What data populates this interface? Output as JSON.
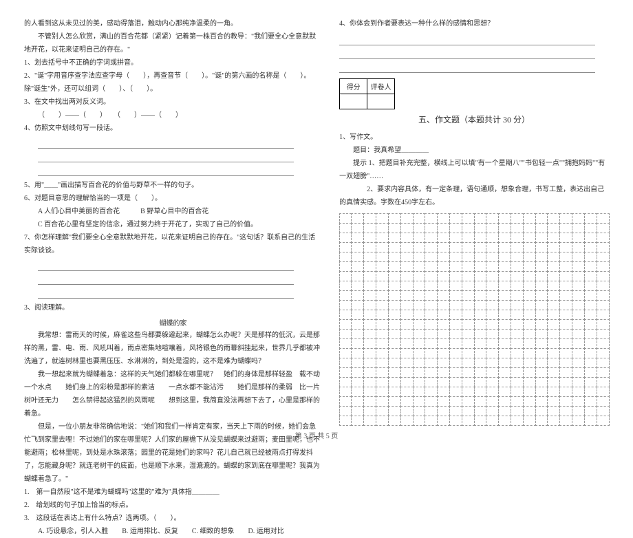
{
  "left": {
    "p_intro1": "的人看到这从未见过的美，感动得落泪，触动内心那纯净温柔的一角。",
    "p_intro2": "不管别人怎么欣赏，满山的百合花都（紧紧）记着第一株百合的教导：\"我们要全心全意默默地开花，以花来证明自己的存在。\"",
    "q1": "1、划去括号中不正确的字词或拼音。",
    "q2": "2、\"诞\"字用音序查字法应查字母（　　），再查音节（　　）。\"诞\"的第六画的名称是（　　）。除\"诞生\"外，还可以组词（　　）、（　　）。",
    "q3": "3、在文中找出两对反义词。",
    "q3_blanks": "（　　）——（　　）　　（　　）——（　　）",
    "q4": "4、仿照文中划线句写一段话。",
    "q5": "5、用\"＿＿\"画出描写百合花的价值与野草不一样的句子。",
    "q6": "6、对题目意思的理解恰当的一项是（　　）。",
    "q6a": "A 人们心目中美丽的百合花　　　B 野草心目中的百合花",
    "q6c": "C 百合花心里有坚定的信念，通过努力终于开花了，实现了自己的价值。",
    "q7": "7、你怎样理解\"我们要全心全意默默地开花，以花来证明自己的存在。\"这句话？联系自己的生活实际谈谈。",
    "q3label": "3、阅读理解。",
    "story_title": "蝴蝶的家",
    "story_p1": "我常想：雷雨天的时候，麻雀这些鸟都要躲避起来，蝴蝶怎么办呢？天是那样的低沉，云是那样的黑，雷、电、雨、风吼叫着，雨点密集地喧嚷着，风将银色的雨幕斜挂起来，世界几乎都被冲洗遍了，就连树林里也要黑压压、水淋淋的，到处是湿的，这不是难为蝴蝶吗？",
    "story_p2": "我一想起来就为蝴蝶着急：这样的天气她们都躲在哪里呢？　她们的身体是那样轻盈　载不动一个水点　　她们身上的彩粉是那样的素洁　　一点水都不能沾污　　她们是那样的柔弱　比一片树叶还无力　　怎么禁得起这猛烈的风雨呢　　想到这里，我简直没法再想下去了，心里是那样的着急。",
    "story_p3": "但是，一位小朋友非常确信地说：\"她们和我们一样肯定有家，当天上下雨的时候，她们会急忙飞到家里去哩！不过她们的家在哪里呢？人们家的屋檐下从没见蝴蝶来过避雨；麦田里呢，也不能避雨；松林里呢，到处是水珠滚落；园里的花是她们的家吗？花儿自己就已经被雨点打得发抖了，怎能藏身呢？就连老树干的底面，也是顺下水来，湿漉漉的。蝴蝶的家到底在哪里呢？我真为蝴蝶着急了。\"",
    "sq1": "1.　第一自然段\"这不是难为蝴蝶吗\"这里的\"难为\"具体指＿＿＿＿",
    "sq2": "2.　给划线的句子加上恰当的标点。",
    "sq3": "3.　这段话在表达上有什么特点？选两项。（　　）。",
    "sq3_opts": "A. 巧设悬念，引人入胜　　B. 运用排比、反复　　C. 细致的想象　　D. 运用对比"
  },
  "right": {
    "q4": "4、你体会到作者要表达一种什么样的感情和思想？",
    "score_de": "得分",
    "score_ping": "评卷人",
    "section5": "五、作文题（本题共计 30 分）",
    "w1": "1、写作文。",
    "w_topic": "题目：我真希望＿＿＿＿",
    "w_tip1": "提示 1、把题目补充完整，横线上可以填\"有一个星期八\"\"书包轻一点\"\"拥抱妈妈\"\"有一双翅膀\"……",
    "w_tip2": "2、要求内容具体，有一定条理，语句通顺，想象合理，书写工整，表达出自己的真情实感。字数在450字左右。"
  },
  "footer": "第 3 页  共 5 页"
}
